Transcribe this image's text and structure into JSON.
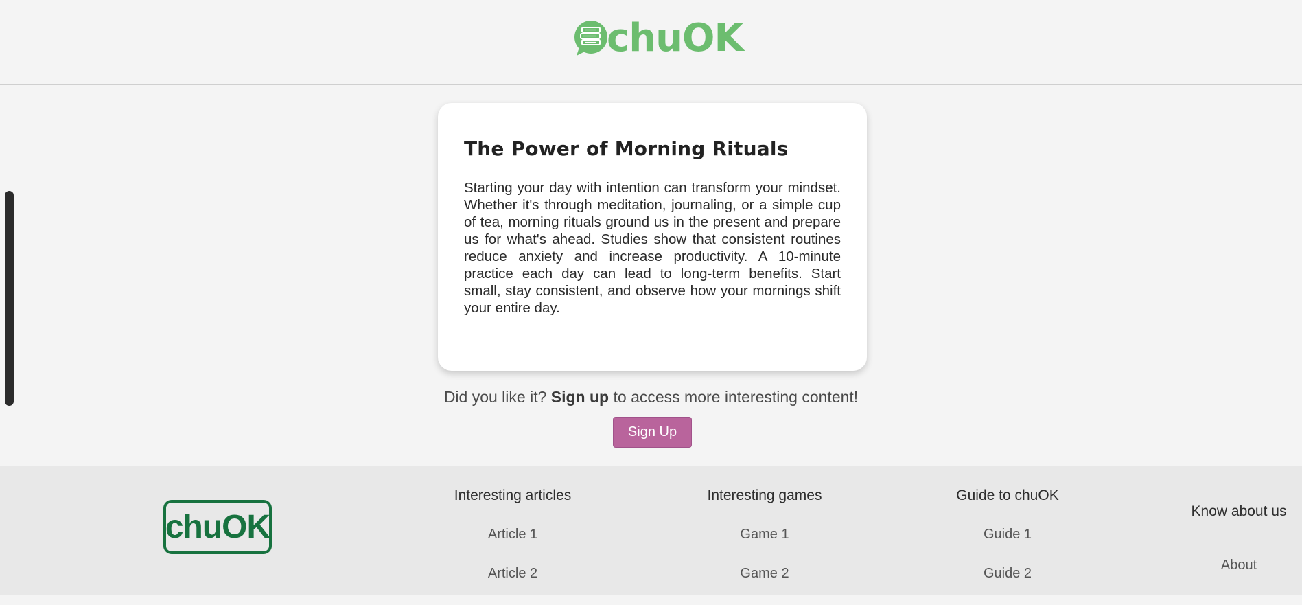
{
  "header": {
    "brand_text": "chuOK",
    "brand_color": "#6cbd6f"
  },
  "article": {
    "title": "The Power of Morning Rituals",
    "body": "Starting your day with intention can transform your mindset. Whether it's through meditation, journaling, or a simple cup of tea, morning rituals ground us in the present and prepare us for what's ahead. Studies show that consistent routines reduce anxiety and increase productivity. A 10-minute practice each day can lead to long-term benefits. Start small, stay consistent, and observe how your mornings shift your entire day."
  },
  "cta": {
    "prefix": "Did you like it?",
    "emphasis": "Sign up",
    "suffix": "to access more interesting content!",
    "button_label": "Sign Up",
    "button_color": "#b9649c"
  },
  "footer": {
    "logo_text": "chuOK",
    "logo_color": "#17723f",
    "columns": [
      {
        "title": "Interesting articles",
        "links": [
          "Article 1",
          "Article 2"
        ]
      },
      {
        "title": "Interesting games",
        "links": [
          "Game 1",
          "Game 2"
        ]
      },
      {
        "title": "Guide to chuOK",
        "links": [
          "Guide 1",
          "Guide 2"
        ]
      },
      {
        "title": "Know about us",
        "links": [
          "About"
        ]
      }
    ]
  }
}
